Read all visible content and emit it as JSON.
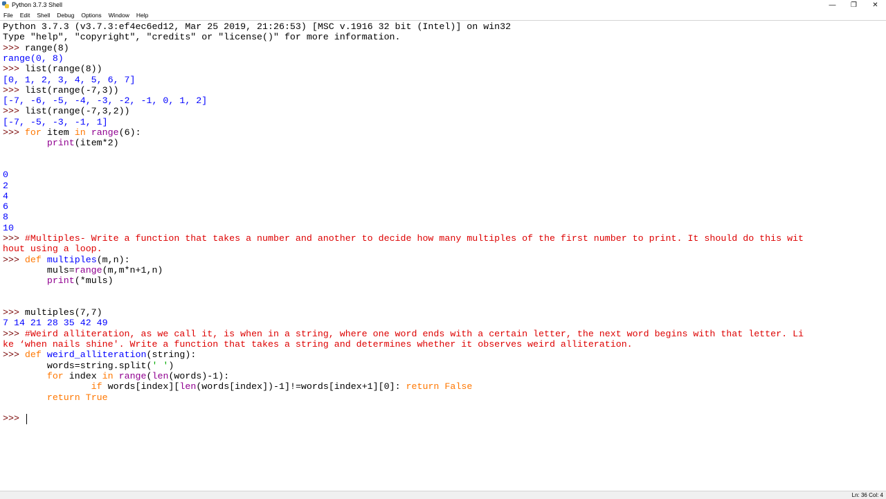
{
  "window": {
    "title": "Python 3.7.3 Shell",
    "controls": {
      "minimize": "—",
      "maximize": "❐",
      "close": "✕"
    }
  },
  "menu": [
    "File",
    "Edit",
    "Shell",
    "Debug",
    "Options",
    "Window",
    "Help"
  ],
  "shell": {
    "prompt": ">>> ",
    "lines": [
      {
        "t": 0,
        "segs": [
          {
            "c": "",
            "v": "Python 3.7.3 (v3.7.3:ef4ec6ed12, Mar 25 2019, 21:26:53) [MSC v.1916 32 bit (Intel)] on win32"
          }
        ]
      },
      {
        "t": 1,
        "segs": [
          {
            "c": "",
            "v": "Type \"help\", \"copyright\", \"credits\" or \"license()\" for more information."
          }
        ]
      },
      {
        "t": 2,
        "segs": [
          {
            "c": "prompt",
            "v": ">>> "
          },
          {
            "c": "",
            "v": "range(8)"
          }
        ]
      },
      {
        "t": 3,
        "segs": [
          {
            "c": "out",
            "v": "range(0, 8)"
          }
        ]
      },
      {
        "t": 4,
        "segs": [
          {
            "c": "prompt",
            "v": ">>> "
          },
          {
            "c": "",
            "v": "list(range(8))"
          }
        ]
      },
      {
        "t": 5,
        "segs": [
          {
            "c": "out",
            "v": "[0, 1, 2, 3, 4, 5, 6, 7]"
          }
        ]
      },
      {
        "t": 6,
        "segs": [
          {
            "c": "prompt",
            "v": ">>> "
          },
          {
            "c": "",
            "v": "list(range(-7,3))"
          }
        ]
      },
      {
        "t": 7,
        "segs": [
          {
            "c": "out",
            "v": "[-7, -6, -5, -4, -3, -2, -1, 0, 1, 2]"
          }
        ]
      },
      {
        "t": 8,
        "segs": [
          {
            "c": "prompt",
            "v": ">>> "
          },
          {
            "c": "",
            "v": "list(range(-7,3,2))"
          }
        ]
      },
      {
        "t": 9,
        "segs": [
          {
            "c": "out",
            "v": "[-7, -5, -3, -1, 1]"
          }
        ]
      },
      {
        "t": 10,
        "segs": [
          {
            "c": "prompt",
            "v": ">>> "
          },
          {
            "c": "kw",
            "v": "for"
          },
          {
            "c": "",
            "v": " item "
          },
          {
            "c": "kw",
            "v": "in"
          },
          {
            "c": "",
            "v": " "
          },
          {
            "c": "bi",
            "v": "range"
          },
          {
            "c": "",
            "v": "(6):"
          }
        ]
      },
      {
        "t": 11,
        "segs": [
          {
            "c": "",
            "v": "        "
          },
          {
            "c": "bi",
            "v": "print"
          },
          {
            "c": "",
            "v": "(item*2)"
          }
        ]
      },
      {
        "t": 14,
        "segs": [
          {
            "c": "out",
            "v": "0"
          }
        ]
      },
      {
        "t": 15,
        "segs": [
          {
            "c": "out",
            "v": "2"
          }
        ]
      },
      {
        "t": 16,
        "segs": [
          {
            "c": "out",
            "v": "4"
          }
        ]
      },
      {
        "t": 17,
        "segs": [
          {
            "c": "out",
            "v": "6"
          }
        ]
      },
      {
        "t": 18,
        "segs": [
          {
            "c": "out",
            "v": "8"
          }
        ]
      },
      {
        "t": 19,
        "segs": [
          {
            "c": "out",
            "v": "10"
          }
        ]
      },
      {
        "t": 20,
        "segs": [
          {
            "c": "prompt",
            "v": ">>> "
          },
          {
            "c": "cmt",
            "v": "#Multiples- Write a function that takes a number and another to decide how many multiples of the first number to print. It should do this wit"
          }
        ]
      },
      {
        "t": 21,
        "segs": [
          {
            "c": "cmt",
            "v": "hout using a loop."
          }
        ]
      },
      {
        "t": 22,
        "segs": [
          {
            "c": "prompt",
            "v": ">>> "
          },
          {
            "c": "kw",
            "v": "def"
          },
          {
            "c": "",
            "v": " "
          },
          {
            "c": "def",
            "v": "multiples"
          },
          {
            "c": "",
            "v": "(m,n):"
          }
        ]
      },
      {
        "t": 23,
        "segs": [
          {
            "c": "",
            "v": "        muls="
          },
          {
            "c": "bi",
            "v": "range"
          },
          {
            "c": "",
            "v": "(m,m*n+1,n)"
          }
        ]
      },
      {
        "t": 24,
        "segs": [
          {
            "c": "",
            "v": "        "
          },
          {
            "c": "bi",
            "v": "print"
          },
          {
            "c": "",
            "v": "(*muls)"
          }
        ]
      },
      {
        "t": 27,
        "segs": [
          {
            "c": "prompt",
            "v": ">>> "
          },
          {
            "c": "",
            "v": "multiples(7,7)"
          }
        ]
      },
      {
        "t": 28,
        "segs": [
          {
            "c": "out",
            "v": "7 14 21 28 35 42 49"
          }
        ]
      },
      {
        "t": 29,
        "segs": [
          {
            "c": "prompt",
            "v": ">>> "
          },
          {
            "c": "cmt",
            "v": "#Weird alliteration, as we call it, is when in a string, where one word ends with a certain letter, the next word begins with that letter. Li"
          }
        ]
      },
      {
        "t": 30,
        "segs": [
          {
            "c": "cmt",
            "v": "ke ‘when nails shine'. Write a function that takes a string and determines whether it observes weird alliteration."
          }
        ]
      },
      {
        "t": 31,
        "segs": [
          {
            "c": "prompt",
            "v": ">>> "
          },
          {
            "c": "kw",
            "v": "def"
          },
          {
            "c": "",
            "v": " "
          },
          {
            "c": "def",
            "v": "weird_alliteration"
          },
          {
            "c": "",
            "v": "(string):"
          }
        ]
      },
      {
        "t": 32,
        "segs": [
          {
            "c": "",
            "v": "        words=string.split("
          },
          {
            "c": "str",
            "v": "' '"
          },
          {
            "c": "",
            "v": ")"
          }
        ]
      },
      {
        "t": 33,
        "segs": [
          {
            "c": "",
            "v": "        "
          },
          {
            "c": "kw",
            "v": "for"
          },
          {
            "c": "",
            "v": " index "
          },
          {
            "c": "kw",
            "v": "in"
          },
          {
            "c": "",
            "v": " "
          },
          {
            "c": "bi",
            "v": "range"
          },
          {
            "c": "",
            "v": "("
          },
          {
            "c": "bi",
            "v": "len"
          },
          {
            "c": "",
            "v": "(words)-1):"
          }
        ]
      },
      {
        "t": 34,
        "segs": [
          {
            "c": "",
            "v": "                "
          },
          {
            "c": "kw",
            "v": "if"
          },
          {
            "c": "",
            "v": " words[index]["
          },
          {
            "c": "bi",
            "v": "len"
          },
          {
            "c": "",
            "v": "(words[index])-1]!=words[index+1][0]: "
          },
          {
            "c": "kw",
            "v": "return"
          },
          {
            "c": "",
            "v": " "
          },
          {
            "c": "kw",
            "v": "False"
          }
        ]
      },
      {
        "t": 35,
        "segs": [
          {
            "c": "",
            "v": "        "
          },
          {
            "c": "kw",
            "v": "return"
          },
          {
            "c": "",
            "v": " "
          },
          {
            "c": "kw",
            "v": "True"
          }
        ]
      },
      {
        "t": 37,
        "segs": [
          {
            "c": "prompt",
            "v": ">>> "
          }
        ]
      }
    ]
  },
  "status": {
    "text": "Ln: 36   Col: 4"
  }
}
